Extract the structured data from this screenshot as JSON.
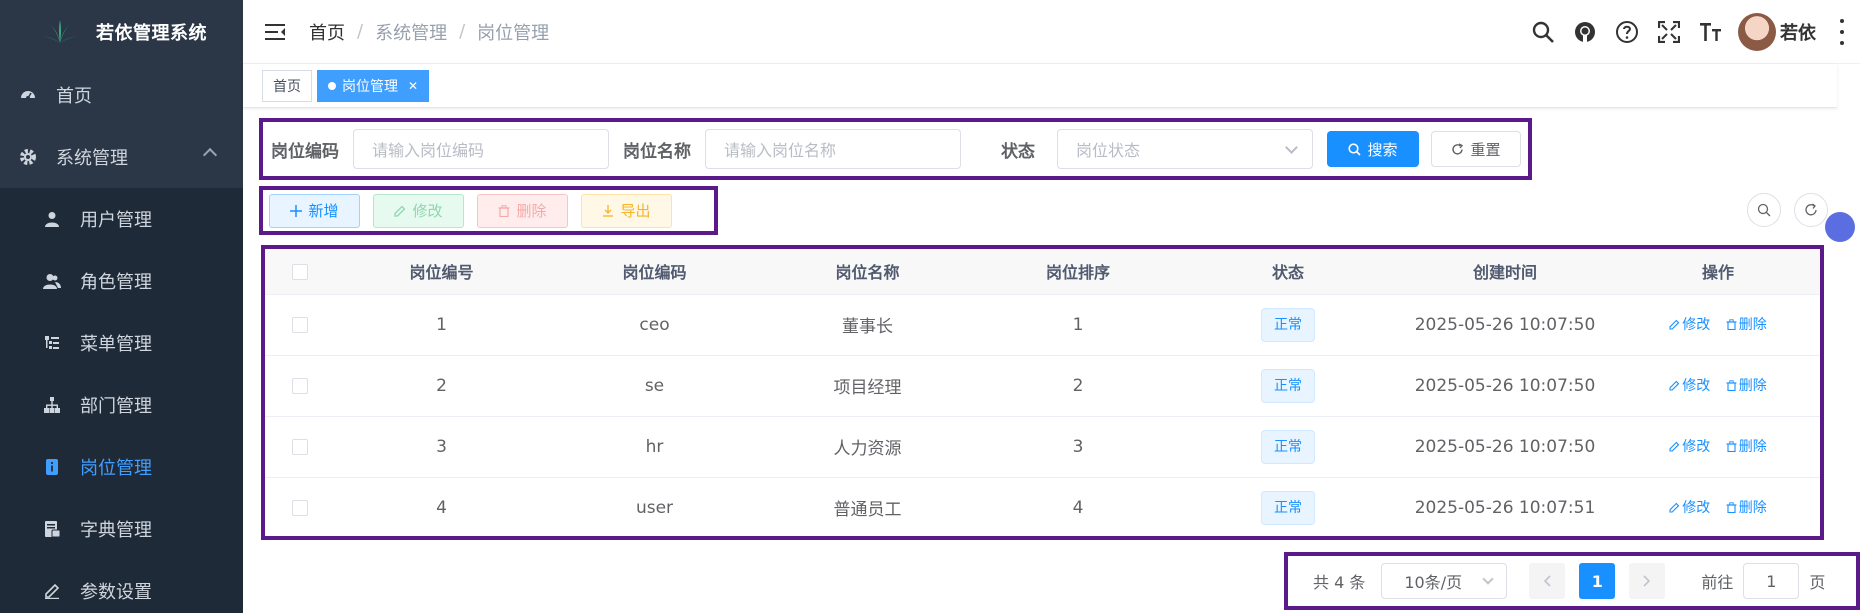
{
  "app": {
    "title": "若依管理系统"
  },
  "sidebar": {
    "home": "首页",
    "system": "系统管理",
    "items": [
      {
        "label": "用户管理",
        "icon": "user-icon"
      },
      {
        "label": "角色管理",
        "icon": "peoples-icon"
      },
      {
        "label": "菜单管理",
        "icon": "tree-table-icon"
      },
      {
        "label": "部门管理",
        "icon": "tree-icon"
      },
      {
        "label": "岗位管理",
        "icon": "post-icon",
        "active": true
      },
      {
        "label": "字典管理",
        "icon": "dict-icon"
      },
      {
        "label": "参数设置",
        "icon": "edit-icon"
      }
    ]
  },
  "header": {
    "breadcrumb": [
      "首页",
      "系统管理",
      "岗位管理"
    ],
    "username": "若依"
  },
  "tags": {
    "home": "首页",
    "current": "岗位管理"
  },
  "search": {
    "code_label": "岗位编码",
    "code_placeholder": "请输入岗位编码",
    "name_label": "岗位名称",
    "name_placeholder": "请输入岗位名称",
    "status_label": "状态",
    "status_placeholder": "岗位状态",
    "search_btn": "搜索",
    "reset_btn": "重置"
  },
  "toolbar": {
    "add": "新增",
    "edit": "修改",
    "delete": "删除",
    "export": "导出"
  },
  "table": {
    "headers": [
      "岗位编号",
      "岗位编码",
      "岗位名称",
      "岗位排序",
      "状态",
      "创建时间",
      "操作"
    ],
    "rows": [
      {
        "id": "1",
        "code": "ceo",
        "name": "董事长",
        "sort": "1",
        "status": "正常",
        "created": "2025-05-26 10:07:50"
      },
      {
        "id": "2",
        "code": "se",
        "name": "项目经理",
        "sort": "2",
        "status": "正常",
        "created": "2025-05-26 10:07:50"
      },
      {
        "id": "3",
        "code": "hr",
        "name": "人力资源",
        "sort": "3",
        "status": "正常",
        "created": "2025-05-26 10:07:50"
      },
      {
        "id": "4",
        "code": "user",
        "name": "普通员工",
        "sort": "4",
        "status": "正常",
        "created": "2025-05-26 10:07:51"
      }
    ],
    "op_edit": "修改",
    "op_delete": "删除"
  },
  "pagination": {
    "total": "共 4 条",
    "page_size": "10条/页",
    "current_page": "1",
    "goto_label": "前往",
    "goto_value": "1",
    "page_suffix": "页"
  },
  "colors": {
    "sidebar_bg": "#2b3646",
    "primary": "#1890ff",
    "highlight_border": "#5a1a8a"
  }
}
